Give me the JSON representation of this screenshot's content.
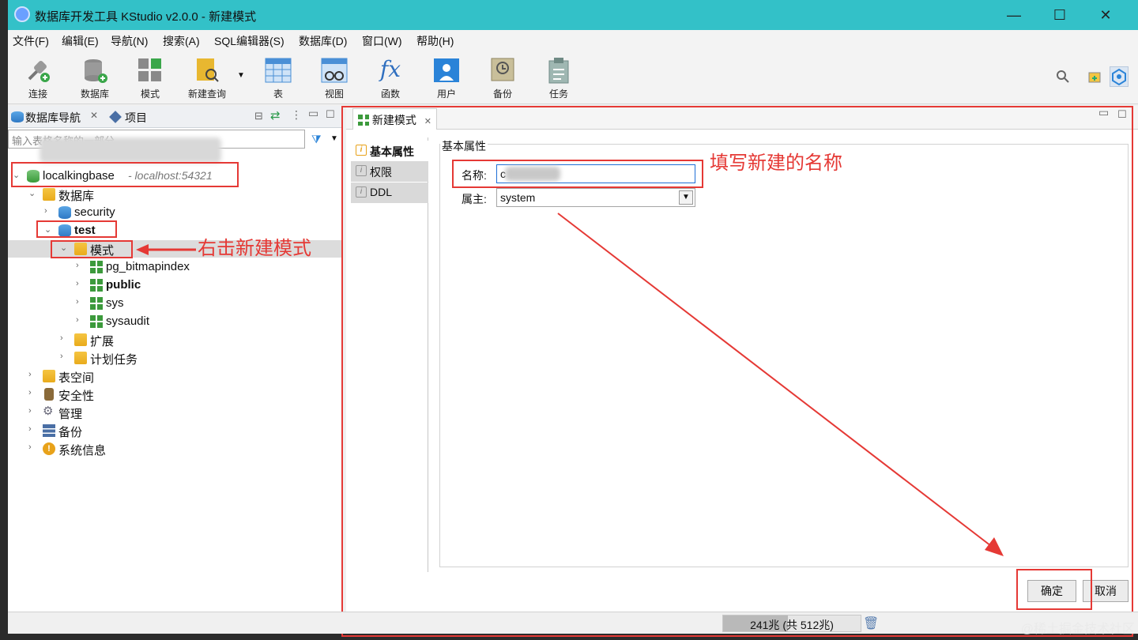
{
  "window": {
    "title": "数据库开发工具 KStudio v2.0.0 - 新建模式",
    "controls": [
      "—",
      "☐",
      "✕"
    ]
  },
  "menu": [
    "文件(F)",
    "编辑(E)",
    "导航(N)",
    "搜索(A)",
    "SQL编辑器(S)",
    "数据库(D)",
    "窗口(W)",
    "帮助(H)"
  ],
  "toolbar": [
    "连接",
    "数据库",
    "模式",
    "新建查询",
    "表",
    "视图",
    "函数",
    "用户",
    "备份",
    "任务"
  ],
  "left_panel": {
    "tab_navigator": "数据库导航",
    "tab_project": "项目",
    "filter_placeholder": "输入表格名称的一部分",
    "connection": {
      "name": "localkingbase",
      "host": "- localhost:54321"
    },
    "tree": [
      {
        "label": "数据库"
      },
      {
        "label": "security"
      },
      {
        "label": "test"
      },
      {
        "label": "模式"
      },
      {
        "label": "pg_bitmapindex"
      },
      {
        "label": "public"
      },
      {
        "label": "sys"
      },
      {
        "label": "sysaudit"
      },
      {
        "label": "扩展"
      },
      {
        "label": "计划任务"
      },
      {
        "label": "表空间"
      },
      {
        "label": "安全性"
      },
      {
        "label": "管理"
      },
      {
        "label": "备份"
      },
      {
        "label": "系统信息"
      }
    ]
  },
  "editor": {
    "tab": "新建模式",
    "side_tabs": [
      "基本属性",
      "权限",
      "DDL"
    ],
    "group_title": "基本属性",
    "name_label": "名称:",
    "name_value": "c",
    "owner_label": "属主:",
    "owner_value": "system",
    "ok": "确定",
    "cancel": "取消"
  },
  "status": {
    "heap": "241兆 (共 512兆)",
    "heap_used_fraction": 0.47
  },
  "annotations": {
    "right_click": "右击新建模式",
    "fill_name": "填写新建的名称"
  },
  "watermark": "@稀土掘金技术社区",
  "colors": {
    "titlebar": "#33c1c8",
    "annotation": "#e53935"
  }
}
